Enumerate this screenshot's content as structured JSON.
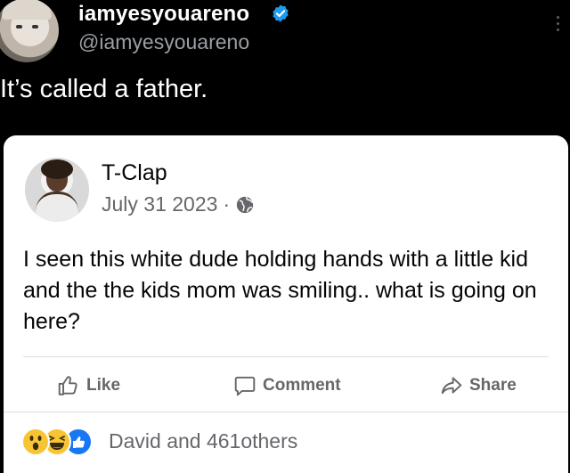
{
  "tweet": {
    "display_name": "iamyesyouareno",
    "handle": "@iamyesyouareno",
    "text": "It’s called a father.",
    "verified_color": "#1d9bf0"
  },
  "post": {
    "author": "T-Clap",
    "date": "July 31 2023",
    "meta_separator": "·",
    "body": "I seen this white dude holding hands with a little kid and the the kids mom was smiling.. what is going on here?",
    "actions": {
      "like_label": "Like",
      "comment_label": "Comment",
      "share_label": "Share"
    },
    "reactions": {
      "icons": [
        "wow-reaction-icon",
        "haha-reaction-icon",
        "like-reaction-icon"
      ],
      "summary": "David and 461others"
    },
    "like_color": "#1877f2"
  }
}
